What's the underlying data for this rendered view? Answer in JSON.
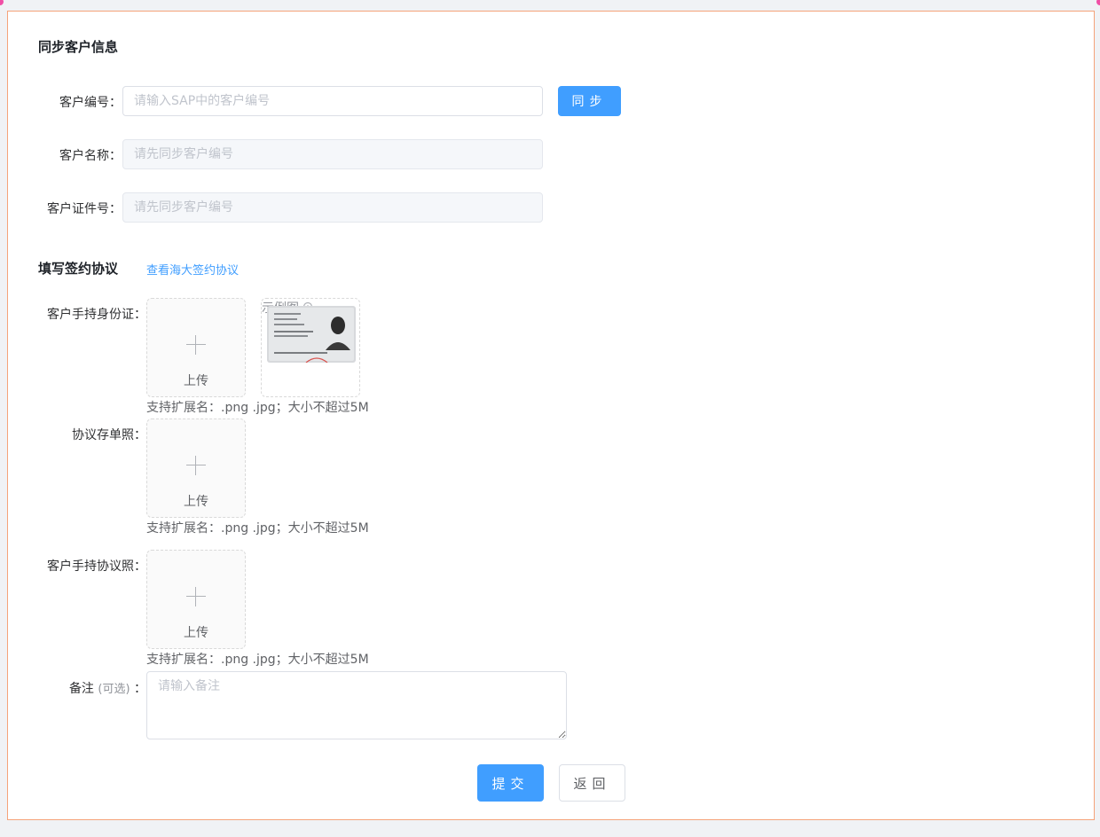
{
  "section1": {
    "title": "同步客户信息",
    "customer_no": {
      "label": "客户编号：",
      "placeholder": "请输入SAP中的客户编号"
    },
    "sync_button": "同步",
    "customer_name": {
      "label": "客户名称：",
      "placeholder": "请先同步客户编号"
    },
    "customer_id": {
      "label": "客户证件号：",
      "placeholder": "请先同步客户编号"
    }
  },
  "section2": {
    "title": "填写签约协议",
    "view_link": "查看海大签约协议",
    "id_photo": {
      "label": "客户手持身份证：",
      "upload": "上传",
      "sample": "示例图",
      "hint": "支持扩展名：.png .jpg；大小不超过5M"
    },
    "agreement_photo": {
      "label": "协议存单照：",
      "upload": "上传",
      "hint": "支持扩展名：.png .jpg；大小不超过5M"
    },
    "holding_photo": {
      "label": "客户手持协议照：",
      "upload": "上传",
      "hint": "支持扩展名：.png .jpg；大小不超过5M"
    },
    "remark": {
      "label": "备注",
      "optional": "(可选)",
      "colon": "：",
      "placeholder": "请输入备注"
    }
  },
  "actions": {
    "submit": "提交",
    "back": "返回"
  },
  "colors": {
    "primary": "#409eff",
    "border_accent": "#f5a37a",
    "corner": "#f04fa6"
  },
  "icons": {
    "zoom": "zoom-in-icon",
    "plus": "plus-icon"
  }
}
